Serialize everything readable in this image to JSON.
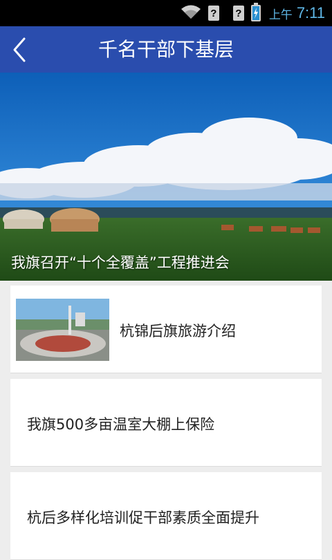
{
  "status_bar": {
    "am_label": "上午",
    "time": "7:11",
    "icons": [
      "wifi-icon",
      "signal-unknown-icon",
      "signal-unknown-icon",
      "battery-charging-icon"
    ]
  },
  "app_bar": {
    "title": "千名干部下基层",
    "back_icon": "chevron-left-icon"
  },
  "hero": {
    "caption": "我旗召开“十个全覆盖”工程推进会"
  },
  "news_list": [
    {
      "title": "杭锦后旗旅游介绍",
      "has_thumbnail": true
    },
    {
      "title": "我旗500多亩温室大棚上保险",
      "has_thumbnail": false
    },
    {
      "title": "杭后多样化培训促干部素质全面提升",
      "has_thumbnail": false
    }
  ],
  "colors": {
    "app_bar": "#2a4dae",
    "status_bar": "#000000",
    "background": "#ededed",
    "clock": "#5fb7e6"
  }
}
